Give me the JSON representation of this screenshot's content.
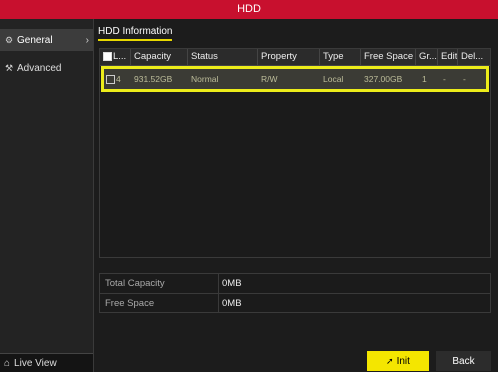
{
  "window": {
    "title": "HDD"
  },
  "sidebar": {
    "items": [
      {
        "label": "General",
        "icon": "gear-icon",
        "active": true
      },
      {
        "label": "Advanced",
        "icon": "tools-icon",
        "active": false
      }
    ],
    "live_view_label": "Live View"
  },
  "tabs": [
    {
      "label": "HDD Information"
    }
  ],
  "table": {
    "columns": [
      "L...",
      "Capacity",
      "Status",
      "Property",
      "Type",
      "Free Space",
      "Gr...",
      "Edit",
      "Del..."
    ],
    "rows": [
      {
        "label": "4",
        "capacity": "931.52GB",
        "status": "Normal",
        "property": "R/W",
        "type": "Local",
        "free_space": "327.00GB",
        "group": "1",
        "edit": "-",
        "delete": "-"
      }
    ]
  },
  "summary": {
    "total_capacity_label": "Total Capacity",
    "total_capacity_value": "0MB",
    "free_space_label": "Free Space",
    "free_space_value": "0MB"
  },
  "buttons": {
    "init": "Init",
    "back": "Back"
  },
  "colors": {
    "title_bar": "#c8102e",
    "highlight": "#ecec1a",
    "init_button": "#f4e600"
  }
}
